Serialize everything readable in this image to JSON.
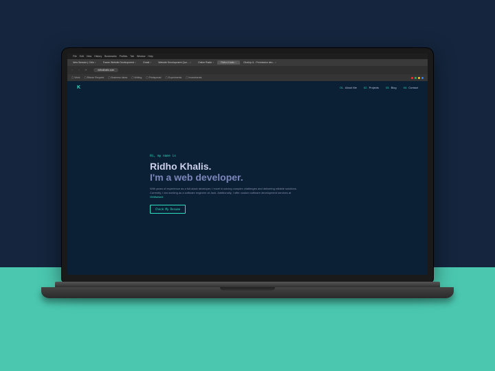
{
  "colors": {
    "accent": "#2de0c3",
    "bg_dark": "#0c2035",
    "text_muted": "#8892b0",
    "heading_light": "#ccd0ea",
    "heading_dim": "#7a86bc"
  },
  "menubar": {
    "apple": "",
    "items": [
      "File",
      "Edit",
      "View",
      "History",
      "Bookmarks",
      "Profiles",
      "Tab",
      "Window",
      "Help"
    ]
  },
  "tabs": [
    {
      "label": "New Session | Odin"
    },
    {
      "label": "Frame Website Development"
    },
    {
      "label": "Gmail"
    },
    {
      "label": "Website Development Que..."
    },
    {
      "label": "Online Radio"
    },
    {
      "label": "Ridho Khalis",
      "active": true
    },
    {
      "label": "ClickUp & - Permission dev..."
    }
  ],
  "addrbar": {
    "back": "‹",
    "fwd": "›",
    "reload": "⟳",
    "url": "ridhokhalis.com"
  },
  "bookmarks": [
    {
      "label": "Work"
    },
    {
      "label": "Bitcoin Request"
    },
    {
      "label": "Business Ideas"
    },
    {
      "label": "Writing"
    },
    {
      "label": "Printspread"
    },
    {
      "label": "Experiments"
    },
    {
      "label": "Investments"
    }
  ],
  "nav": {
    "logo": "K",
    "links": [
      {
        "num": "01.",
        "label": "About Me"
      },
      {
        "num": "02.",
        "label": "Projects"
      },
      {
        "num": "03.",
        "label": "Blog"
      },
      {
        "num": "04.",
        "label": "Contact"
      }
    ]
  },
  "hero": {
    "greeting": "Hi, my name is",
    "name": "Ridho Khalis.",
    "tagline": "I'm a web developer.",
    "desc_pre": "With years of experience as a full-stack developer, I excel in solving complex challenges and delivering reliable solutions. Currently, I am working as a software engineer at Jack. Additionally, I offer custom software development services at ",
    "desc_highlight": "Orbitwised",
    "desc_post": ".",
    "cta": "Check My Resume"
  }
}
